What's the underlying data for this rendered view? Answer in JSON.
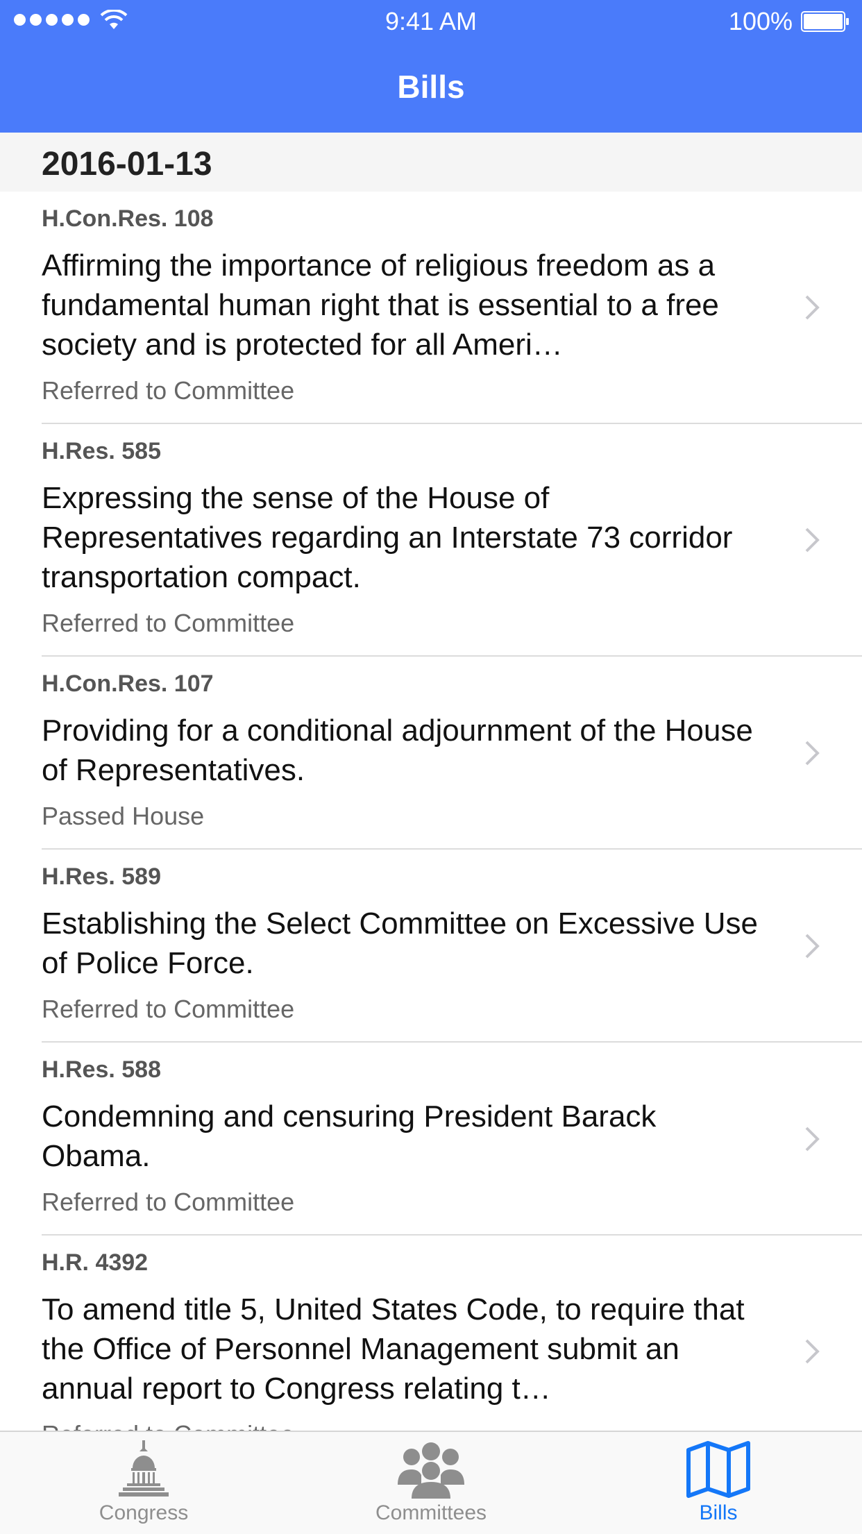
{
  "status_bar": {
    "time": "9:41 AM",
    "battery": "100%"
  },
  "header": {
    "title": "Bills"
  },
  "section": {
    "date": "2016-01-13"
  },
  "bills": [
    {
      "number": "H.Con.Res. 108",
      "title": "Affirming the importance of religious freedom as a fundamental human right that is essential to a free society and is protected for all Ameri…",
      "status": "Referred to Committee"
    },
    {
      "number": "H.Res. 585",
      "title": "Expressing the sense of the House of Representatives regarding an Interstate 73 corridor transportation compact.",
      "status": "Referred to Committee"
    },
    {
      "number": "H.Con.Res. 107",
      "title": "Providing for a conditional adjournment of the House of Representatives.",
      "status": "Passed House"
    },
    {
      "number": "H.Res. 589",
      "title": "Establishing the Select Committee on Excessive Use of Police Force.",
      "status": "Referred to Committee"
    },
    {
      "number": "H.Res. 588",
      "title": "Condemning and censuring President Barack Obama.",
      "status": "Referred to Committee"
    },
    {
      "number": "H.R. 4392",
      "title": "To amend title 5, United States Code, to require that the Office of Personnel Management submit an annual report to Congress relating t…",
      "status": "Referred to Committee"
    }
  ],
  "tabs": [
    {
      "label": "Congress",
      "icon": "capitol-icon"
    },
    {
      "label": "Committees",
      "icon": "group-icon"
    },
    {
      "label": "Bills",
      "icon": "map-icon"
    }
  ],
  "colors": {
    "header": "#4A7BFA",
    "active_tab": "#1477F8",
    "inactive_tab": "#8E8E8E"
  }
}
